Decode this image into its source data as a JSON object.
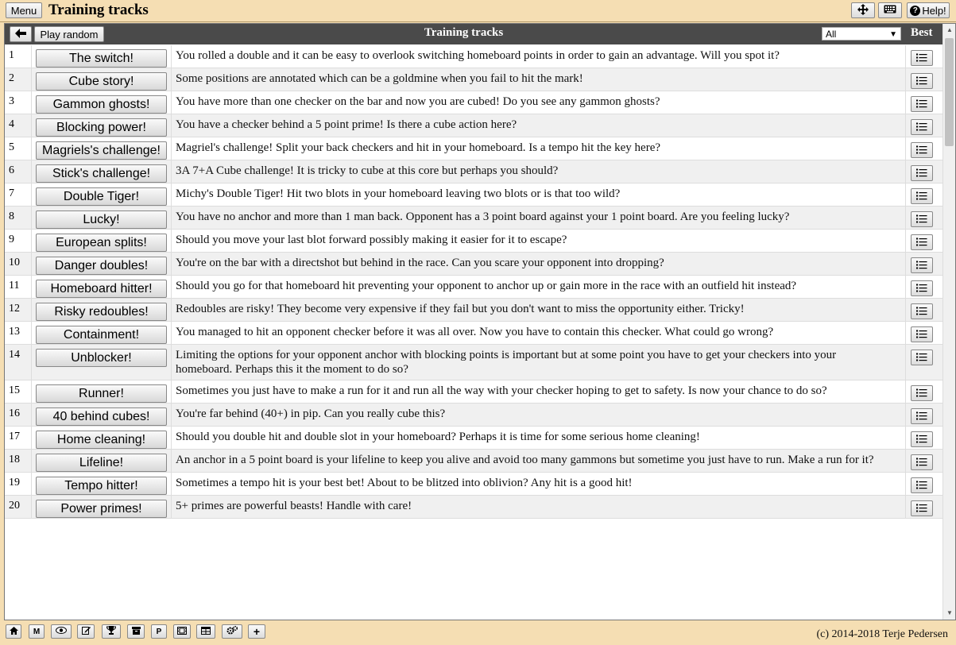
{
  "header": {
    "menu_label": "Menu",
    "app_title": "Training tracks",
    "help_label": "Help!",
    "help_glyph": "?"
  },
  "panel": {
    "play_random_label": "Play random",
    "title": "Training tracks",
    "filter_value": "All",
    "best_label": "Best"
  },
  "tracks": [
    {
      "num": "1",
      "name": "The switch!",
      "desc": "You rolled a double and it can be easy to overlook switching homeboard points in order to gain an advantage. Will you spot it?"
    },
    {
      "num": "2",
      "name": "Cube story!",
      "desc": "Some positions are annotated which can be a goldmine when you fail to hit the mark!"
    },
    {
      "num": "3",
      "name": "Gammon ghosts!",
      "desc": "You have more than one checker on the bar and now you are cubed! Do you see any gammon ghosts?"
    },
    {
      "num": "4",
      "name": "Blocking power!",
      "desc": "You have a checker behind a 5 point prime! Is there a cube action here?"
    },
    {
      "num": "5",
      "name": "Magriels's challenge!",
      "desc": "Magriel's challenge! Split your back checkers and hit in your homeboard. Is a tempo hit the key here?"
    },
    {
      "num": "6",
      "name": "Stick's challenge!",
      "desc": "3A 7+A Cube challenge! It is tricky to cube at this core but perhaps you should?"
    },
    {
      "num": "7",
      "name": "Double Tiger!",
      "desc": "Michy's Double Tiger! Hit two blots in your homeboard leaving two blots or is that too wild?"
    },
    {
      "num": "8",
      "name": "Lucky!",
      "desc": "You have no anchor and more than 1 man back. Opponent has a 3 point board against your 1 point board. Are you feeling lucky?"
    },
    {
      "num": "9",
      "name": "European splits!",
      "desc": "Should you move your last blot forward possibly making it easier for it to escape?"
    },
    {
      "num": "10",
      "name": "Danger doubles!",
      "desc": "You're on the bar with a directshot but behind in the race. Can you scare your opponent into dropping?"
    },
    {
      "num": "11",
      "name": "Homeboard hitter!",
      "desc": "Should you go for that homeboard hit preventing your opponent to anchor up or gain more in the race with an outfield hit instead?"
    },
    {
      "num": "12",
      "name": "Risky redoubles!",
      "desc": "Redoubles are risky! They become very expensive if they fail but you don't want to miss the opportunity either. Tricky!"
    },
    {
      "num": "13",
      "name": "Containment!",
      "desc": "You managed to hit an opponent checker before it was all over. Now you have to contain this checker. What could go wrong?"
    },
    {
      "num": "14",
      "name": "Unblocker!",
      "desc": "Limiting the options for your opponent anchor with blocking points is important but at some point you have to get your checkers into your homeboard. Perhaps this it the moment to do so?"
    },
    {
      "num": "15",
      "name": "Runner!",
      "desc": "Sometimes you just have to make a run for it and run all the way with your checker hoping to get to safety. Is now your chance to do so?"
    },
    {
      "num": "16",
      "name": "40 behind cubes!",
      "desc": "You're far behind (40+) in pip. Can you really cube this?"
    },
    {
      "num": "17",
      "name": "Home cleaning!",
      "desc": "Should you double hit and double slot in your homeboard? Perhaps it is time for some serious home cleaning!"
    },
    {
      "num": "18",
      "name": "Lifeline!",
      "desc": "An anchor in a 5 point board is your lifeline to keep you alive and avoid too many gammons but sometime you just have to run. Make a run for it?"
    },
    {
      "num": "19",
      "name": "Tempo hitter!",
      "desc": "Sometimes a tempo hit is your best bet! About to be blitzed into oblivion? Any hit is a good hit!"
    },
    {
      "num": "20",
      "name": "Power primes!",
      "desc": "5+ primes are powerful beasts! Handle with care!"
    }
  ],
  "toolbar": {
    "m_label": "M",
    "p_label": "P",
    "plus_label": "+",
    "icons": [
      "home-icon",
      "m-icon",
      "eye-icon",
      "edit-icon",
      "trophy-icon",
      "box-icon",
      "p-icon",
      "film-icon",
      "table-icon",
      "gears-icon",
      "plus-icon"
    ]
  },
  "footer": {
    "copyright": "(c) 2014-2018 Terje Pedersen"
  }
}
